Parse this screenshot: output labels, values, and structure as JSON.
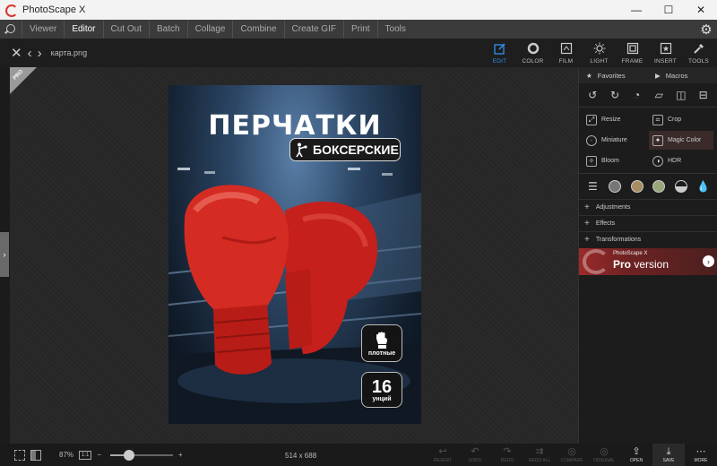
{
  "window": {
    "title": "PhotoScape X",
    "controls": [
      "—",
      "☐",
      "✕"
    ]
  },
  "menu": {
    "items": [
      "Viewer",
      "Editor",
      "Cut Out",
      "Batch",
      "Collage",
      "Combine",
      "Create GIF",
      "Print",
      "Tools"
    ],
    "active": "Editor"
  },
  "toolbar": {
    "filename": "карта.png",
    "modes": [
      {
        "label": "EDIT",
        "icon": "edit-icon",
        "active": true
      },
      {
        "label": "COLOR",
        "icon": "color-icon",
        "active": false
      },
      {
        "label": "FILM",
        "icon": "film-icon",
        "active": false
      },
      {
        "label": "LIGHT",
        "icon": "light-icon",
        "active": false
      },
      {
        "label": "FRAME",
        "icon": "frame-icon",
        "active": false
      },
      {
        "label": "INSERT",
        "icon": "insert-icon",
        "active": false
      },
      {
        "label": "TOOLS",
        "icon": "tools-icon",
        "active": false
      }
    ]
  },
  "badge": {
    "pro": "PRO"
  },
  "poster": {
    "title": "ПЕРЧАТКИ",
    "subtitle": "БОКСЕРСКИЕ",
    "badge_dense": "плотные",
    "badge_oz_number": "16",
    "badge_oz_label": "унций"
  },
  "panel": {
    "tabs": [
      "Favorites",
      "Macros"
    ],
    "tools": [
      {
        "label": "Resize",
        "icon": "resize-icon"
      },
      {
        "label": "Crop",
        "icon": "crop-icon"
      },
      {
        "label": "Miniature",
        "icon": "miniature-icon"
      },
      {
        "label": "Magic Color",
        "icon": "magic-color-icon"
      },
      {
        "label": "Bloom",
        "icon": "bloom-icon"
      },
      {
        "label": "HDR",
        "icon": "hdr-icon"
      }
    ],
    "sections": [
      "Adjustments",
      "Effects",
      "Transformations"
    ],
    "pro_banner": {
      "small": "PhotoScape X",
      "big_bold": "Pro",
      "big_rest": " version"
    }
  },
  "status": {
    "zoom": "87%",
    "one_to_one": "1:1",
    "zoom_level": 0.3,
    "dimensions": "514 x 688",
    "actions": [
      {
        "label": "REVERT",
        "icon": "revert-icon",
        "enabled": false
      },
      {
        "label": "UNDO",
        "icon": "undo-icon",
        "enabled": false
      },
      {
        "label": "REDO",
        "icon": "redo-icon",
        "enabled": false
      },
      {
        "label": "REDO ALL",
        "icon": "redo-all-icon",
        "enabled": false
      },
      {
        "label": "COMPARE",
        "icon": "compare-icon",
        "enabled": false
      },
      {
        "label": "ORIGINAL",
        "icon": "original-icon",
        "enabled": false
      },
      {
        "label": "OPEN",
        "icon": "open-icon",
        "enabled": true
      },
      {
        "label": "SAVE",
        "icon": "save-icon",
        "enabled": true
      },
      {
        "label": "MORE",
        "icon": "more-icon",
        "enabled": true
      }
    ]
  }
}
